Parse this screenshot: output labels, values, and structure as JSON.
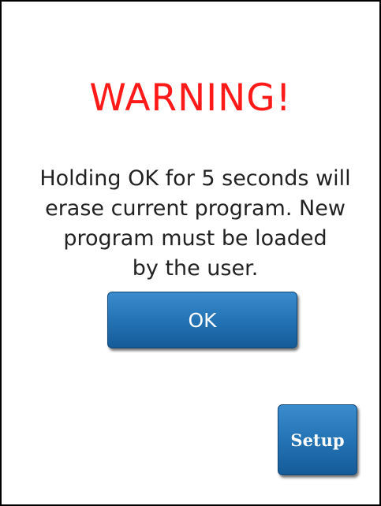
{
  "dialog": {
    "title": "WARNING!",
    "message_lines": [
      "Holding OK for 5 seconds will",
      "erase current program. New",
      "program must be loaded",
      "by the user."
    ],
    "ok_label": "OK",
    "setup_label": "Setup"
  },
  "colors": {
    "title": "#ff1a1a",
    "button": "#2676b8",
    "text": "#222222",
    "background": "#ffffff",
    "border": "#000000"
  }
}
